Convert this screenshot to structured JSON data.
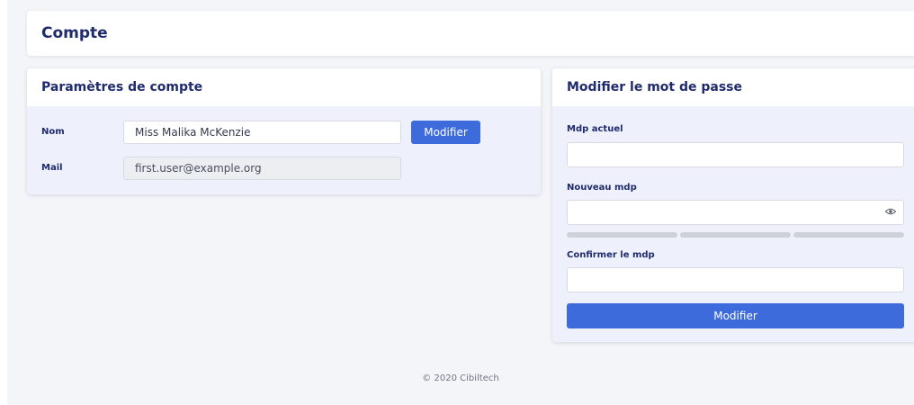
{
  "page": {
    "title": "Compte"
  },
  "account_settings": {
    "title": "Paramètres de compte",
    "name_label": "Nom",
    "name_value": "Miss Malika McKenzie",
    "modify_button": "Modifier",
    "mail_label": "Mail",
    "mail_value": "first.user@example.org"
  },
  "password_change": {
    "title": "Modifier le mot de passe",
    "current_label": "Mdp actuel",
    "current_value": "",
    "new_label": "Nouveau mdp",
    "new_value": "",
    "eye_icon": "eye-icon",
    "strength_level": 0,
    "confirm_label": "Confirmer le mdp",
    "confirm_value": "",
    "submit_button": "Modifier"
  },
  "footer": {
    "text": "© 2020 Cibiltech"
  },
  "colors": {
    "primary": "#3d6bdc",
    "heading": "#1f2b6d",
    "panel": "#eef0fb",
    "background": "#f4f5f9"
  }
}
